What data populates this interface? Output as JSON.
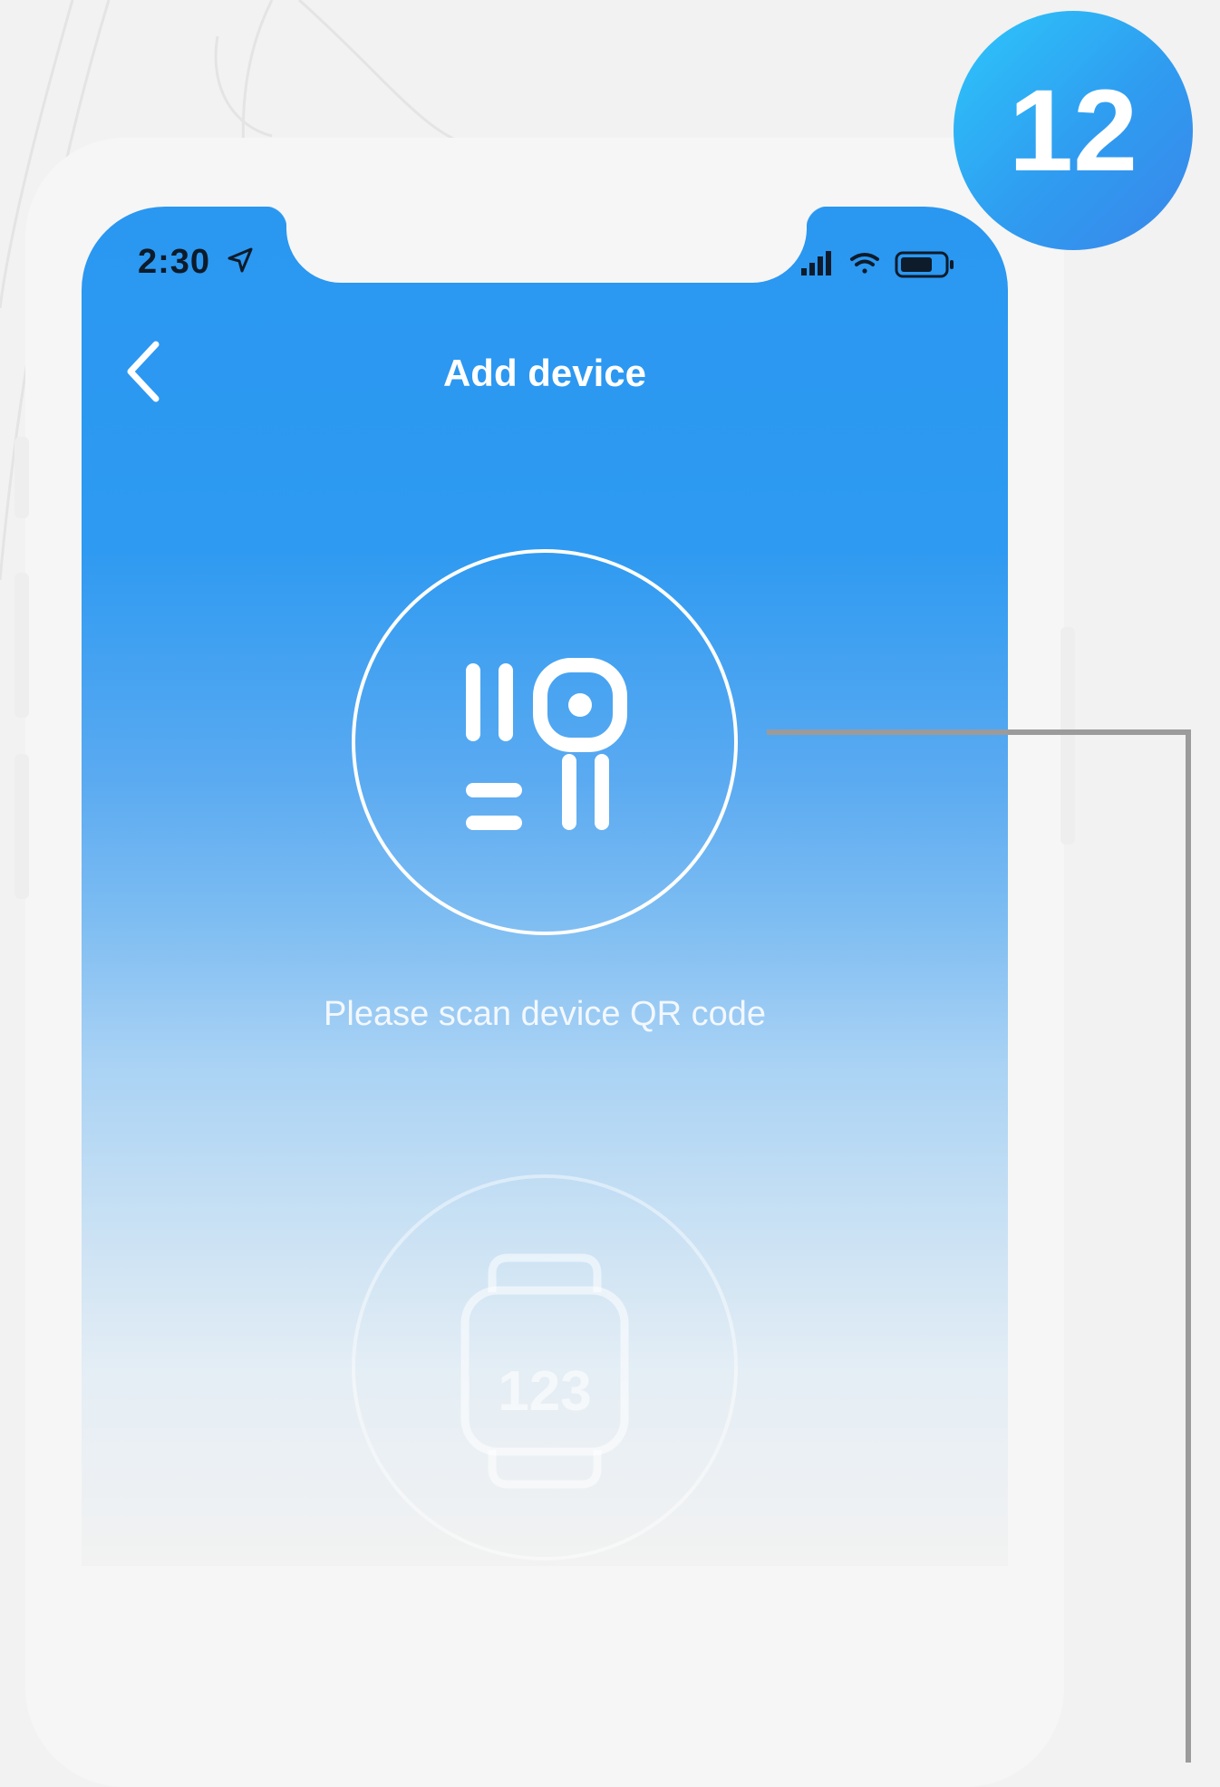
{
  "status_bar": {
    "time": "2:30"
  },
  "header": {
    "title": "Add device"
  },
  "qr_scan": {
    "hint": "Please scan device QR code"
  },
  "watch_option": {
    "code": "123"
  },
  "step_badge": {
    "number": "12"
  },
  "colors": {
    "accent": "#2a97f1",
    "badge": "#2ec7fb",
    "callout_line": "#9b9b9b"
  },
  "icons": [
    "location-arrow-icon",
    "signal-icon",
    "wifi-icon",
    "battery-icon",
    "back-chevron-icon",
    "qr-code-icon",
    "smartwatch-icon"
  ]
}
